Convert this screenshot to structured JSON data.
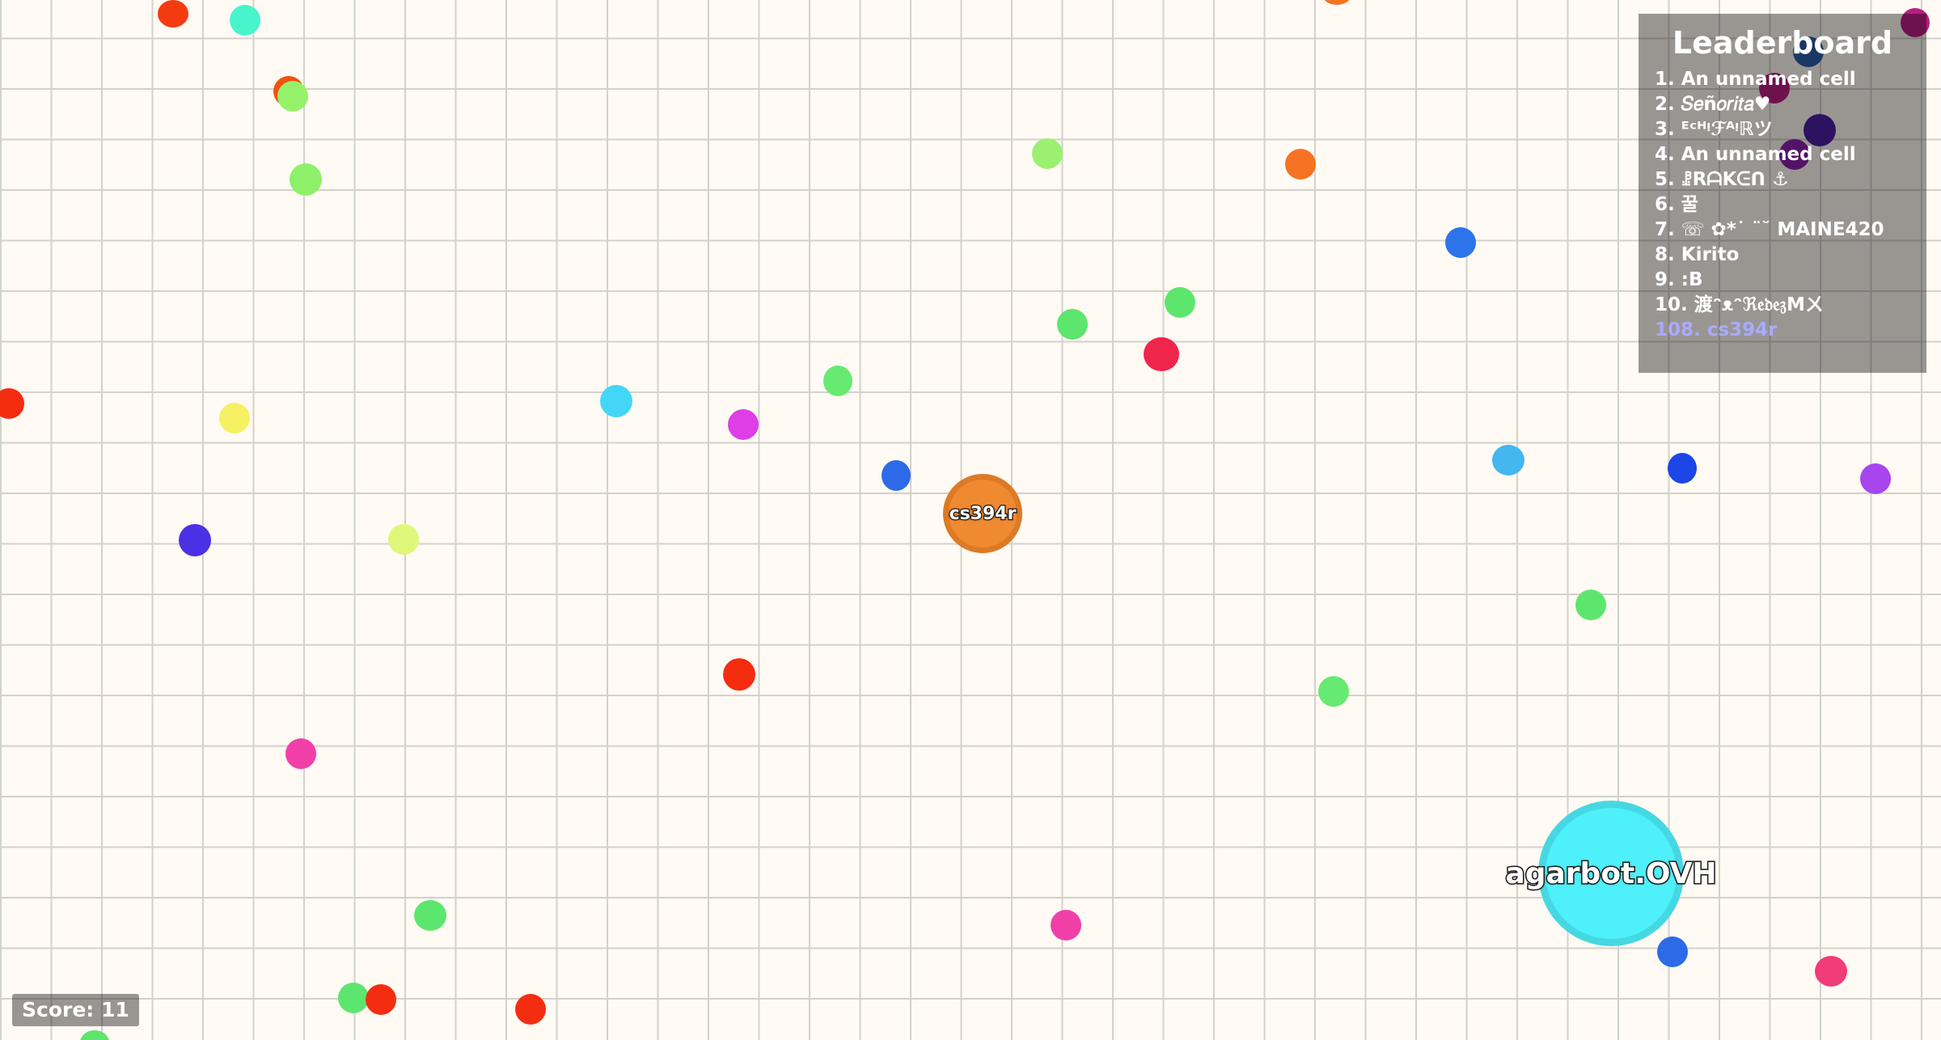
{
  "player": {
    "name": "cs394r",
    "color": "#f08a30"
  },
  "bot": {
    "name": "agarbot.OVH",
    "color": "#4ef0fa"
  },
  "leaderboard": {
    "title": "Leaderboard",
    "entries": [
      "1. An unnamed cell",
      "2. 𝑆𝑒ñ𝑜𝑟𝑖𝑡𝑎♥",
      "3. ᴱᶜᴴᵎℱᴬᵎℝツ",
      "4. An unnamed cell",
      "5.       ꗗRᗩKᕮᑎ ⚓",
      "6. 꿀",
      "7. ☏ ✿*˙ ¨˘ MAINE420",
      "8. Kirito",
      "9. :B",
      "10. 渡ᵔᴥᵔℜ𝔢𝔡𝔢𝔷Mㄨ"
    ],
    "me": "108. cs394r"
  },
  "score": {
    "label": "Score: 11"
  }
}
